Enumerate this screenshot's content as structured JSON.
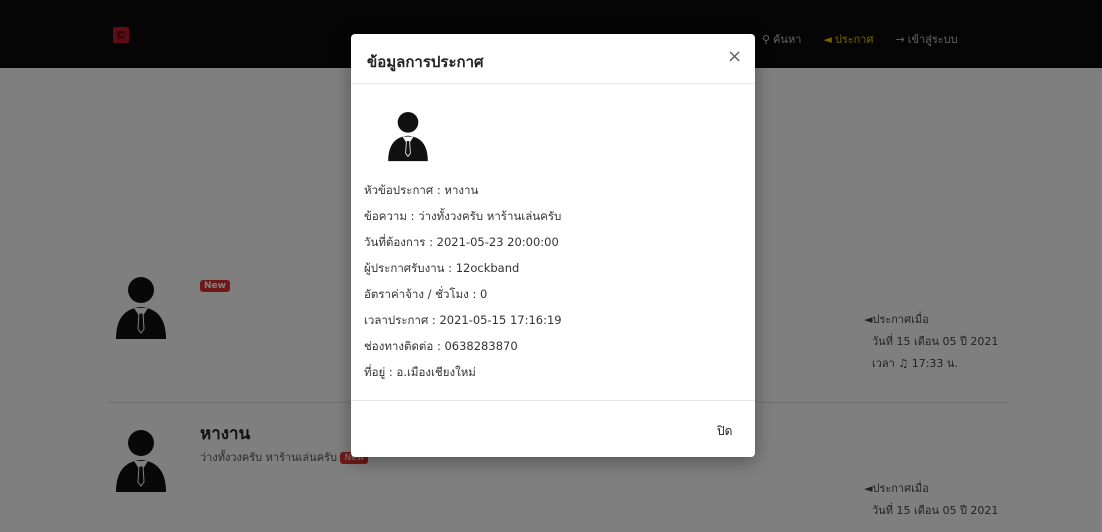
{
  "navbar": {
    "links": [
      {
        "icon": "search-icon",
        "glyph": "⚲",
        "label": "ค้นหา"
      },
      {
        "icon": "megaphone-icon",
        "glyph": "◄",
        "label": "ประกาศ"
      },
      {
        "icon": "sign-in-icon",
        "glyph": "→",
        "label": "เข้าสู่ระบบ"
      }
    ]
  },
  "posts": [
    {
      "title": "",
      "badge": "New",
      "meta": {
        "label": "ประกาศเมื่อ",
        "date": "วันที่ 15 เดือน 05 ปี 2021",
        "time": "เวลา ♫ 17:33 น."
      }
    },
    {
      "title": "หางาน",
      "description": "ว่างทั้งวงครับ หาร้านเล่นครับ",
      "badge": "New",
      "meta": {
        "label": "ประกาศเมื่อ",
        "date": "วันที่ 15 เดือน 05 ปี 2021"
      }
    }
  ],
  "modal": {
    "title": "ข้อมูลการประกาศ",
    "close_symbol": "×",
    "details": [
      "หัวข้อประกาศ : หางาน",
      "ข้อความ : ว่างทั้งวงครับ หาร้านเล่นครับ",
      "วันที่ต้องการ : 2021-05-23 20:00:00",
      "ผู้ประกาศรับงาน : 12ockband",
      "อัตราค่าจ้าง / ชั่วโมง : 0",
      "เวลาประกาศ : 2021-05-15 17:16:19",
      "ช่องทางติดต่อ : 0638283870",
      "ที่อยู่ : อ.เมืองเชียงใหม่"
    ],
    "footer_close_label": "ปิด"
  },
  "colors": {
    "navbar_bg": "#0b0b0b",
    "brand_red": "#c0182b",
    "active_link": "#f3c300",
    "badge_red": "#e03131",
    "backdrop": "rgba(0,0,0,0.5)"
  }
}
